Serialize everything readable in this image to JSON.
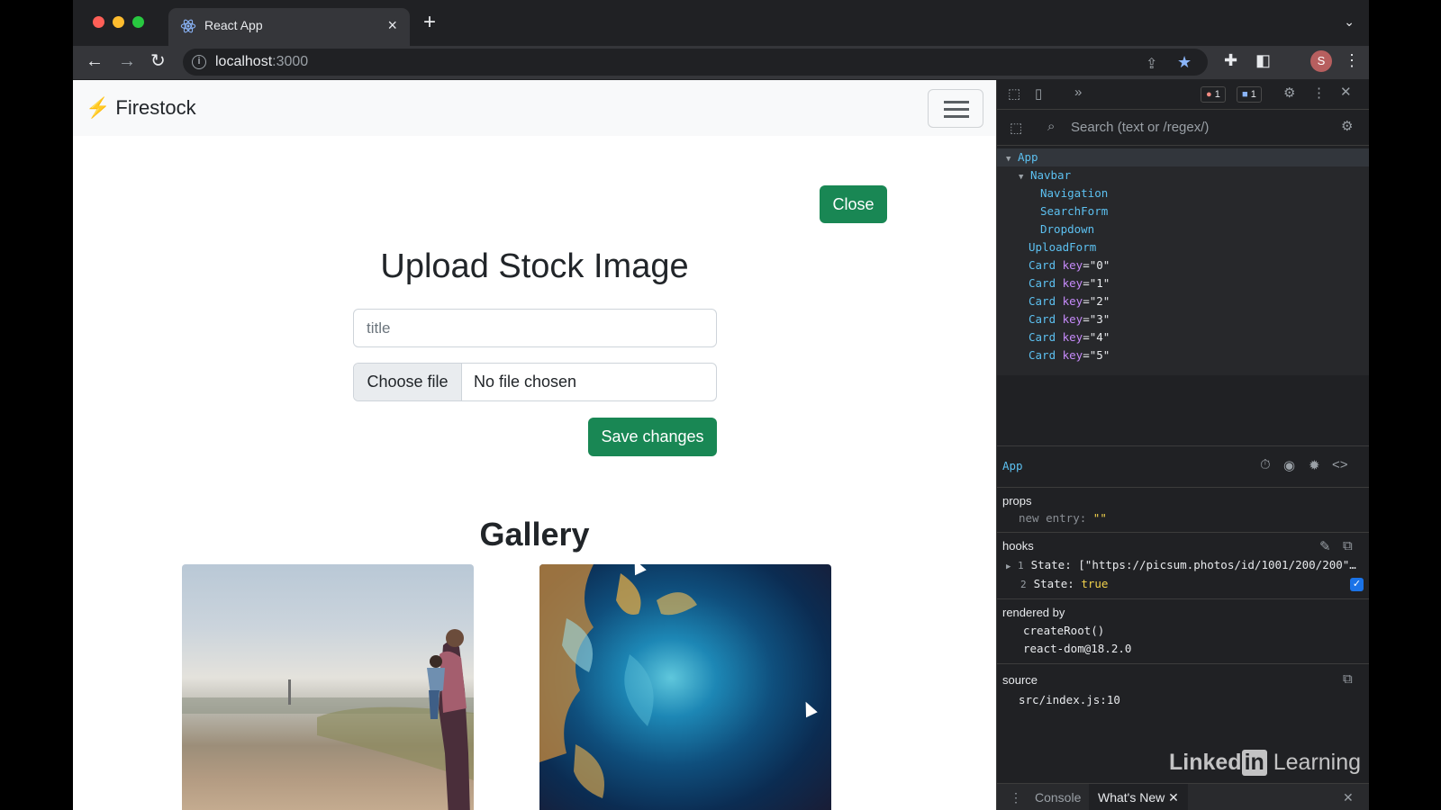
{
  "browser": {
    "tab_title": "React App",
    "url_host": "localhost",
    "url_port": ":3000",
    "avatar_letter": "S"
  },
  "page": {
    "brand": "Firestock",
    "close_label": "Close",
    "heading": "Upload Stock Image",
    "title_placeholder": "title",
    "choose_file_label": "Choose file",
    "no_file_text": "No file chosen",
    "save_label": "Save changes",
    "gallery_heading": "Gallery",
    "accent": "#198754"
  },
  "devtools": {
    "error_count": "1",
    "message_count": "1",
    "search_placeholder": "Search (text or /regex/)",
    "tree": {
      "app": "App",
      "navbar": "Navbar",
      "navigation": "Navigation",
      "searchform": "SearchForm",
      "dropdown": "Dropdown",
      "uploadform": "UploadForm",
      "card_name": "Card",
      "key_attr": " key",
      "keys": [
        "=\"0\"",
        "=\"1\"",
        "=\"2\"",
        "=\"3\"",
        "=\"4\"",
        "=\"5\""
      ]
    },
    "inspect": {
      "selected": "App",
      "props_label": "props",
      "prop_name": "new entry",
      "prop_value": "\"\"",
      "hooks_label": "hooks",
      "hook1_index": "1",
      "hook1_label": "State:",
      "hook1_value": "[\"https://picsum.photos/id/1001/200/200\"…",
      "hook2_index": "2",
      "hook2_label": "State:",
      "hook2_value": "true",
      "rendered_by_label": "rendered by",
      "rendered_by": [
        "createRoot()",
        "react-dom@18.2.0"
      ],
      "source_label": "source",
      "source_value": "src/index.js:10"
    },
    "bottom_tabs": {
      "console": "Console",
      "whats_new": "What's New"
    },
    "watermark": {
      "linked": "Linked",
      "in": "in",
      "learning": " Learning"
    }
  }
}
